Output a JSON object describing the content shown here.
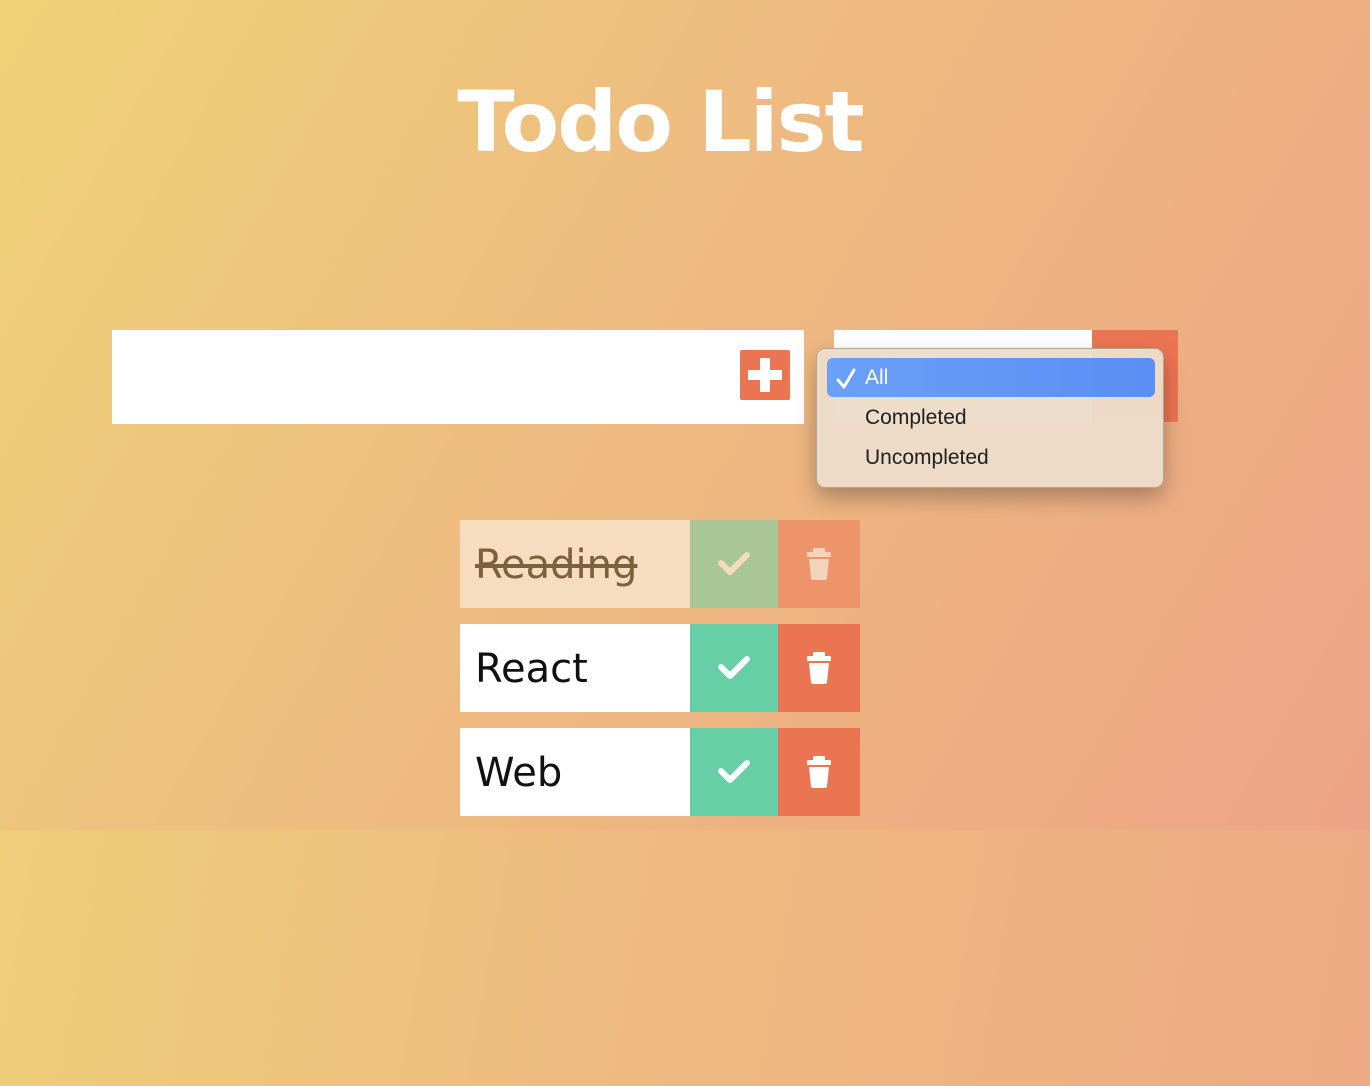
{
  "title": "Todo List",
  "input": {
    "value": "",
    "placeholder": ""
  },
  "add_button": {
    "icon": "plus-square-icon"
  },
  "filter": {
    "selected": "All",
    "options": [
      "All",
      "Completed",
      "Uncompleted"
    ]
  },
  "todos": [
    {
      "text": "Reading",
      "completed": true
    },
    {
      "text": "React",
      "completed": false
    },
    {
      "text": "Web",
      "completed": false
    }
  ],
  "colors": {
    "accent": "#eb7553",
    "complete_button": "#66cfa5",
    "title": "#ffffff",
    "dropdown_highlight": "#5a8ef5"
  }
}
